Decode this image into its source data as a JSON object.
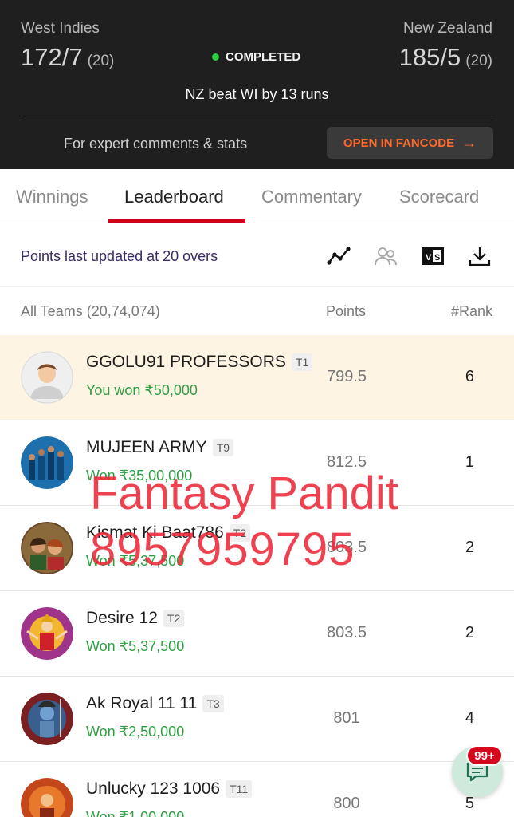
{
  "match": {
    "team_left": {
      "name": "West Indies",
      "score": "172/7",
      "overs": "(20)"
    },
    "team_right": {
      "name": "New Zealand",
      "score": "185/5",
      "overs": "(20)"
    },
    "status": "COMPLETED",
    "result": "NZ beat WI by 13 runs",
    "expert_text": "For expert comments & stats",
    "fancode_button": "OPEN IN FANCODE",
    "fancode_color": "#ff6a2b"
  },
  "tabs": [
    {
      "label": "Winnings"
    },
    {
      "label": "Leaderboard",
      "active": true
    },
    {
      "label": "Commentary"
    },
    {
      "label": "Scorecard"
    }
  ],
  "updated_text": "Points last updated at 20 overs",
  "toolbar_icons": [
    "chart-trend-icon",
    "compare-users-icon",
    "versus-icon",
    "download-icon"
  ],
  "list_header": {
    "teams": "All Teams (20,74,074)",
    "points": "Points",
    "rank": "#Rank"
  },
  "rows": [
    {
      "name": "GGOLU91 PROFESSORS",
      "tag": "T1",
      "won": "You won ₹50,000",
      "points": "799.5",
      "rank": "6"
    },
    {
      "name": "MUJEEN ARMY",
      "tag": "T9",
      "won": "Won ₹35,00,000",
      "points": "812.5",
      "rank": "1"
    },
    {
      "name": "Kismat Ki Baat786",
      "tag": "T2",
      "won": "Won ₹5,37,500",
      "points": "803.5",
      "rank": "2"
    },
    {
      "name": "Desire 12",
      "tag": "T2",
      "won": "Won ₹5,37,500",
      "points": "803.5",
      "rank": "2"
    },
    {
      "name": "Ak Royal 11 11",
      "tag": "T3",
      "won": "Won ₹2,50,000",
      "points": "801",
      "rank": "4"
    },
    {
      "name": "Unlucky 123 1006",
      "tag": "T11",
      "won": "Won ₹1,00,000",
      "points": "800",
      "rank": "5"
    }
  ],
  "watermark": {
    "line1": "Fantasy Pandit",
    "line2": "8957959795"
  },
  "chat": {
    "badge": "99+"
  },
  "colors": {
    "header_bg": "#1f1f1f",
    "active_tab": "#d0021b",
    "won_green": "#2ea043",
    "highlight_row": "#fdf4e3"
  }
}
